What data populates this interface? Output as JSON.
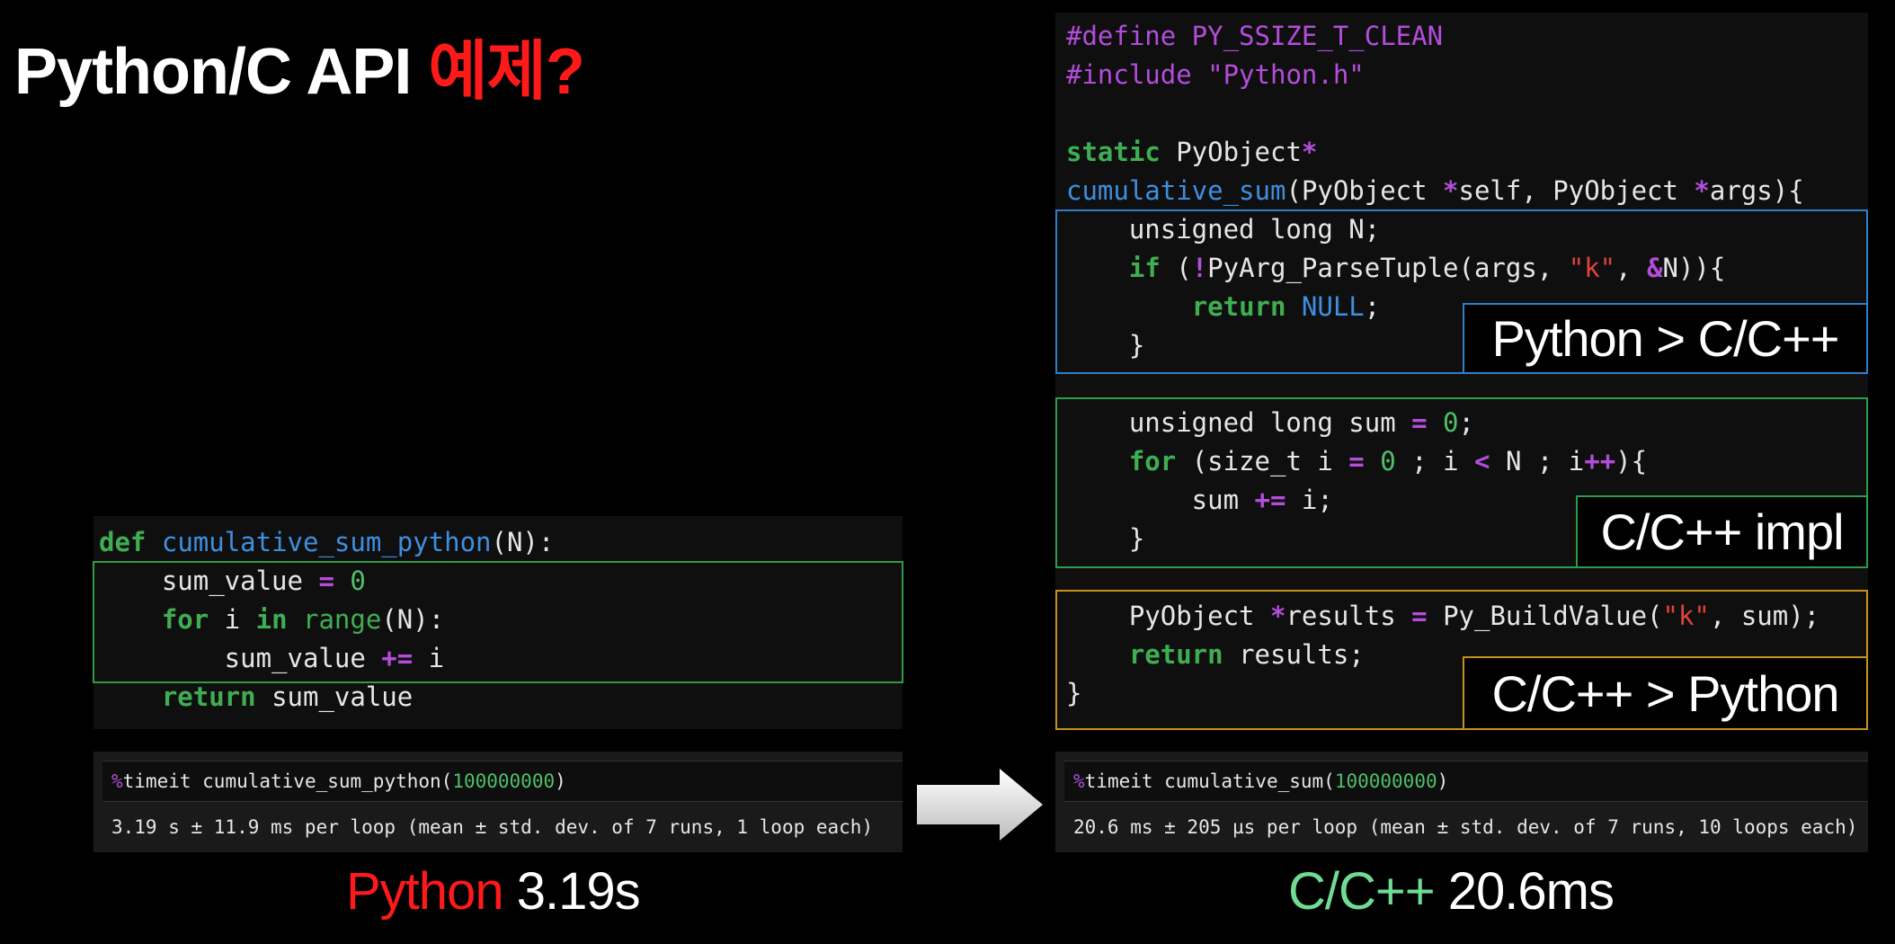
{
  "title": {
    "text": "Python/C API ",
    "highlight": "예제?"
  },
  "python_code": {
    "lines": [
      [
        {
          "t": "def",
          "c": "kw"
        },
        {
          "t": " "
        },
        {
          "t": "cumulative_sum_python",
          "c": "fn"
        },
        {
          "t": "(N):"
        }
      ],
      [
        {
          "t": "    sum_value "
        },
        {
          "t": "=",
          "c": "op"
        },
        {
          "t": " "
        },
        {
          "t": "0",
          "c": "num"
        }
      ],
      [
        {
          "t": "    "
        },
        {
          "t": "for",
          "c": "kw"
        },
        {
          "t": " i "
        },
        {
          "t": "in",
          "c": "kw"
        },
        {
          "t": " "
        },
        {
          "t": "range",
          "c": "builtin"
        },
        {
          "t": "(N):"
        }
      ],
      [
        {
          "t": "        sum_value "
        },
        {
          "t": "+=",
          "c": "op"
        },
        {
          "t": " i"
        }
      ],
      [
        {
          "t": "    "
        },
        {
          "t": "return",
          "c": "kw"
        },
        {
          "t": " sum_value"
        }
      ]
    ]
  },
  "c_code": {
    "lines": [
      [
        {
          "t": "#define PY_SSIZE_T_CLEAN",
          "c": "pp"
        }
      ],
      [
        {
          "t": "#include ",
          "c": "pp"
        },
        {
          "t": "\"Python.h\"",
          "c": "pp"
        }
      ],
      [
        {
          "t": ""
        }
      ],
      [
        {
          "t": "static",
          "c": "kw"
        },
        {
          "t": " PyObject"
        },
        {
          "t": "*",
          "c": "op"
        }
      ],
      [
        {
          "t": "cumulative_sum",
          "c": "fn"
        },
        {
          "t": "(PyObject "
        },
        {
          "t": "*",
          "c": "op"
        },
        {
          "t": "self, PyObject "
        },
        {
          "t": "*",
          "c": "op"
        },
        {
          "t": "args){"
        }
      ],
      [
        {
          "t": "    unsigned long N;"
        }
      ],
      [
        {
          "t": "    "
        },
        {
          "t": "if",
          "c": "kw"
        },
        {
          "t": " ("
        },
        {
          "t": "!",
          "c": "op"
        },
        {
          "t": "PyArg_ParseTuple(args, "
        },
        {
          "t": "\"k\"",
          "c": "str"
        },
        {
          "t": ", "
        },
        {
          "t": "&",
          "c": "op"
        },
        {
          "t": "N)){"
        }
      ],
      [
        {
          "t": "        "
        },
        {
          "t": "return",
          "c": "kw"
        },
        {
          "t": " "
        },
        {
          "t": "NULL",
          "c": "fn"
        },
        {
          "t": ";"
        }
      ],
      [
        {
          "t": "    }"
        }
      ],
      [
        {
          "t": ""
        }
      ],
      [
        {
          "t": "    unsigned long sum "
        },
        {
          "t": "=",
          "c": "op"
        },
        {
          "t": " "
        },
        {
          "t": "0",
          "c": "num"
        },
        {
          "t": ";"
        }
      ],
      [
        {
          "t": "    "
        },
        {
          "t": "for",
          "c": "kw"
        },
        {
          "t": " (size_t i "
        },
        {
          "t": "=",
          "c": "op"
        },
        {
          "t": " "
        },
        {
          "t": "0",
          "c": "num"
        },
        {
          "t": " ; i "
        },
        {
          "t": "<",
          "c": "op"
        },
        {
          "t": " N ; i"
        },
        {
          "t": "++",
          "c": "op"
        },
        {
          "t": "){"
        }
      ],
      [
        {
          "t": "        sum "
        },
        {
          "t": "+=",
          "c": "op"
        },
        {
          "t": " i;"
        }
      ],
      [
        {
          "t": "    }"
        }
      ],
      [
        {
          "t": ""
        }
      ],
      [
        {
          "t": "    PyObject "
        },
        {
          "t": "*",
          "c": "op"
        },
        {
          "t": "results "
        },
        {
          "t": "=",
          "c": "op"
        },
        {
          "t": " Py_BuildValue("
        },
        {
          "t": "\"k\"",
          "c": "str"
        },
        {
          "t": ", sum);"
        }
      ],
      [
        {
          "t": "    "
        },
        {
          "t": "return",
          "c": "kw"
        },
        {
          "t": " results;"
        }
      ],
      [
        {
          "t": "}"
        }
      ]
    ]
  },
  "labels": {
    "py_to_c": "Python > C/C++",
    "impl": "C/C++ impl",
    "c_to_py": "C/C++ > Python"
  },
  "timeit_python": {
    "cmd_prefix": "%",
    "cmd_name": "timeit cumulative_sum_python(",
    "cmd_num": "100000000",
    "cmd_suffix": ")",
    "output": "3.19 s ± 11.9 ms per loop (mean ± std. dev. of 7 runs, 1 loop each)"
  },
  "timeit_c": {
    "cmd_prefix": "%",
    "cmd_name": "timeit cumulative_sum(",
    "cmd_num": "100000000",
    "cmd_suffix": ")",
    "output": "20.6 ms ± 205 µs per loop (mean ± std. dev. of 7 runs, 10 loops each)"
  },
  "results": {
    "python_lang": "Python",
    "python_time": " 3.19s",
    "c_lang": "C/C++",
    "c_time": " 20.6ms"
  },
  "colors": {
    "title_highlight": "#ff1a1a",
    "python_result": "#ff1a1a",
    "c_result": "#6fdc93",
    "box_blue": "#2f7fc8",
    "box_green": "#2f9a4a",
    "box_orange": "#c8921e"
  }
}
